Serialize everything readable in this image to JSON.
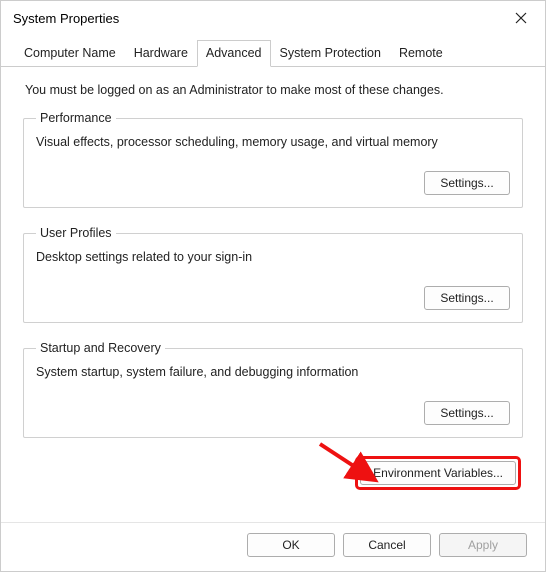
{
  "window": {
    "title": "System Properties"
  },
  "tabs": {
    "items": [
      {
        "label": "Computer Name"
      },
      {
        "label": "Hardware"
      },
      {
        "label": "Advanced"
      },
      {
        "label": "System Protection"
      },
      {
        "label": "Remote"
      }
    ],
    "active_index": 2
  },
  "intro_text": "You must be logged on as an Administrator to make most of these changes.",
  "groups": {
    "performance": {
      "legend": "Performance",
      "desc": "Visual effects, processor scheduling, memory usage, and virtual memory",
      "button": "Settings..."
    },
    "user_profiles": {
      "legend": "User Profiles",
      "desc": "Desktop settings related to your sign-in",
      "button": "Settings..."
    },
    "startup": {
      "legend": "Startup and Recovery",
      "desc": "System startup, system failure, and debugging information",
      "button": "Settings..."
    }
  },
  "env_button": "Environment Variables...",
  "dialog_buttons": {
    "ok": "OK",
    "cancel": "Cancel",
    "apply": "Apply"
  },
  "annotation": {
    "highlight_target": "environment-variables-button",
    "arrow_color": "#e11"
  }
}
